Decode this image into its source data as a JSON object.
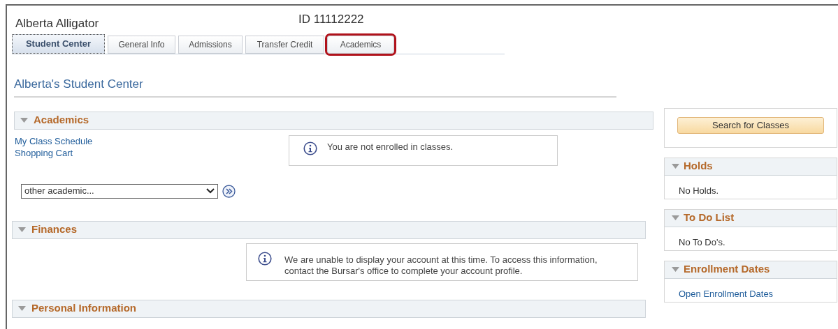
{
  "student": {
    "name": "Alberta Alligator",
    "id": "ID 11112222"
  },
  "tabs": [
    {
      "label": "Student Center",
      "selected": true,
      "highlighted": false
    },
    {
      "label": "General Info",
      "selected": false,
      "highlighted": false
    },
    {
      "label": "Admissions",
      "selected": false,
      "highlighted": false
    },
    {
      "label": "Transfer Credit",
      "selected": false,
      "highlighted": false
    },
    {
      "label": "Academics",
      "selected": false,
      "highlighted": true
    }
  ],
  "page_title": "Alberta's Student Center",
  "academics": {
    "title": "Academics",
    "expanded": true,
    "links": [
      "My Class Schedule",
      "Shopping Cart"
    ],
    "notice": "You are not enrolled in classes.",
    "dropdown": {
      "value": "other academic..."
    }
  },
  "finances": {
    "title": "Finances",
    "expanded": true,
    "notice": "We are unable to display your account at this time.  To access this information, contact the Bursar's office to complete your account profile."
  },
  "personal_information": {
    "title": "Personal Information",
    "expanded": true
  },
  "search_button": "Search for Classes",
  "side_panels": [
    {
      "title": "Holds",
      "expanded": true,
      "kind": "text",
      "body": "No Holds."
    },
    {
      "title": "To Do List",
      "expanded": true,
      "kind": "text",
      "body": "No To Do's."
    },
    {
      "title": "Enrollment Dates",
      "expanded": true,
      "kind": "link",
      "body": "Open Enrollment Dates"
    }
  ]
}
